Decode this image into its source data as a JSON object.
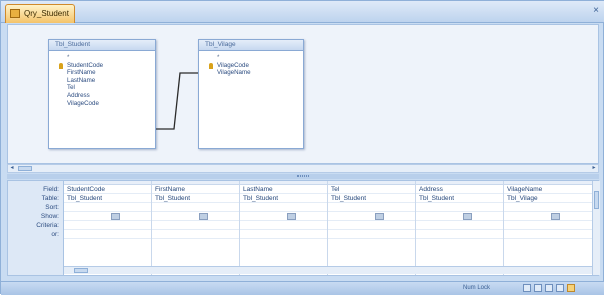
{
  "tab": {
    "title": "Qry_Student",
    "close": "×"
  },
  "tables": [
    {
      "title": "Tbl_Student",
      "fields": [
        "*",
        "StudentCode",
        "FirstName",
        "LastName",
        "Tel",
        "Address",
        "VilageCode"
      ]
    },
    {
      "title": "Tbl_Vilage",
      "fields": [
        "*",
        "VilageCode",
        "VilageName"
      ]
    }
  ],
  "grid": {
    "row_labels": [
      "Field:",
      "Table:",
      "Sort:",
      "Show:",
      "Criteria:",
      "or:"
    ],
    "columns": [
      {
        "field": "StudentCode",
        "table": "Tbl_Student",
        "show": true
      },
      {
        "field": "FirstName",
        "table": "Tbl_Student",
        "show": true
      },
      {
        "field": "LastName",
        "table": "Tbl_Student",
        "show": true
      },
      {
        "field": "Tel",
        "table": "Tbl_Student",
        "show": true
      },
      {
        "field": "Address",
        "table": "Tbl_Student",
        "show": true
      },
      {
        "field": "VilageName",
        "table": "Tbl_Vilage",
        "show": true
      }
    ]
  },
  "status": {
    "text": "Num Lock"
  }
}
